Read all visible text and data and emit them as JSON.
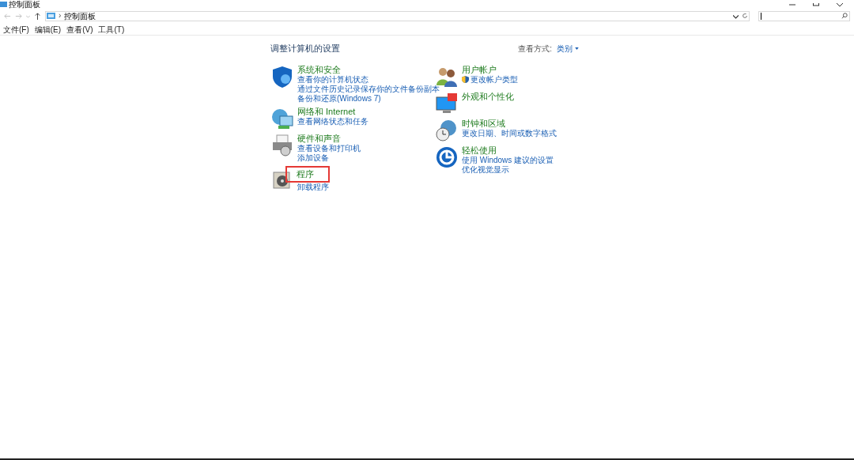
{
  "window": {
    "title": "控制面板"
  },
  "address": {
    "separator": "›",
    "crumb": "控制面板"
  },
  "menu": [
    "文件(F)",
    "编辑(E)",
    "查看(V)",
    "工具(T)"
  ],
  "heading": "调整计算机的设置",
  "view_by": {
    "label": "查看方式:",
    "value": "类别"
  },
  "columns": [
    [
      {
        "kind": "shield",
        "title": "系统和安全",
        "highlighted": false,
        "links": [
          {
            "text": "查看你的计算机状态"
          },
          {
            "text": "通过文件历史记录保存你的文件备份副本"
          },
          {
            "text": "备份和还原(Windows 7)"
          }
        ]
      },
      {
        "kind": "globe",
        "title": "网络和 Internet",
        "highlighted": false,
        "links": [
          {
            "text": "查看网络状态和任务"
          }
        ]
      },
      {
        "kind": "printer",
        "title": "硬件和声音",
        "highlighted": false,
        "links": [
          {
            "text": "查看设备和打印机"
          },
          {
            "text": "添加设备"
          }
        ]
      },
      {
        "kind": "disc",
        "title": "程序",
        "highlighted": true,
        "links": [
          {
            "text": "卸载程序"
          }
        ]
      }
    ],
    [
      {
        "kind": "users",
        "title": "用户帐户",
        "highlighted": false,
        "links": [
          {
            "text": "更改帐户类型",
            "shield": true
          }
        ]
      },
      {
        "kind": "monitor",
        "title": "外观和个性化",
        "highlighted": false
      },
      {
        "kind": "clock",
        "title": "时钟和区域",
        "highlighted": false,
        "links": [
          {
            "text": "更改日期、时间或数字格式"
          }
        ]
      },
      {
        "kind": "access",
        "title": "轻松使用",
        "highlighted": false,
        "links": [
          {
            "text": "使用 Windows 建议的设置"
          },
          {
            "text": "优化视觉显示"
          }
        ]
      }
    ]
  ]
}
